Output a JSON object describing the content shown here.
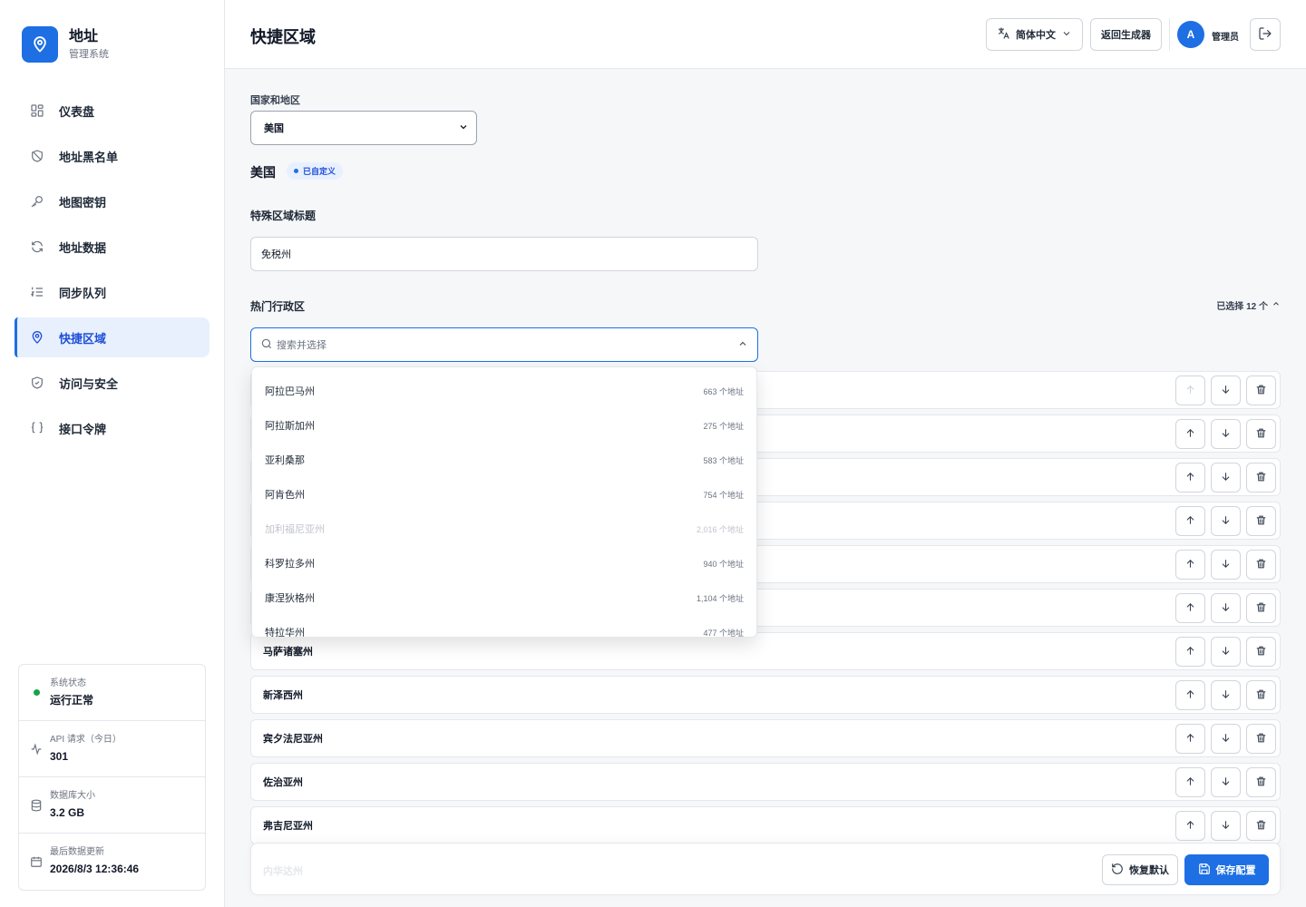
{
  "brand": {
    "title": "地址",
    "subtitle": "管理系统"
  },
  "nav": [
    {
      "label": "仪表盘",
      "icon": "dashboard-icon"
    },
    {
      "label": "地址黑名单",
      "icon": "shield-slash-icon"
    },
    {
      "label": "地图密钥",
      "icon": "key-icon"
    },
    {
      "label": "地址数据",
      "icon": "refresh-icon"
    },
    {
      "label": "同步队列",
      "icon": "list-ordered-icon"
    },
    {
      "label": "快捷区域",
      "icon": "map-pin-icon",
      "active": true
    },
    {
      "label": "访问与安全",
      "icon": "shield-check-icon"
    },
    {
      "label": "接口令牌",
      "icon": "braces-icon"
    }
  ],
  "status": {
    "system_label": "系统状态",
    "system_value": "运行正常",
    "api_label": "API 请求（今日）",
    "api_value": "301",
    "db_label": "数据库大小",
    "db_value": "3.2 GB",
    "update_label": "最后数据更新",
    "update_value": "2026/8/3 12:36:46"
  },
  "header": {
    "title": "快捷区域",
    "language": "简体中文",
    "back_label": "返回生成器",
    "avatar_initial": "A",
    "user_name": "管理员"
  },
  "form": {
    "country_label": "国家和地区",
    "country_value": "美国",
    "country_heading": "美国",
    "custom_badge": "已自定义",
    "special_title_label": "特殊区域标题",
    "special_title_value": "免税州",
    "popular_label": "热门行政区",
    "selected_count": "已选择 12 个",
    "search_placeholder": "搜索并选择"
  },
  "dropdown": [
    {
      "name": "阿拉巴马州",
      "count": "663 个地址",
      "disabled": false
    },
    {
      "name": "阿拉斯加州",
      "count": "275 个地址",
      "disabled": false
    },
    {
      "name": "亚利桑那",
      "count": "583 个地址",
      "disabled": false
    },
    {
      "name": "阿肯色州",
      "count": "754 个地址",
      "disabled": false
    },
    {
      "name": "加利福尼亚州",
      "count": "2,016 个地址",
      "disabled": true
    },
    {
      "name": "科罗拉多州",
      "count": "940 个地址",
      "disabled": false
    },
    {
      "name": "康涅狄格州",
      "count": "1,104 个地址",
      "disabled": false
    },
    {
      "name": "特拉华州",
      "count": "477 个地址",
      "disabled": false
    }
  ],
  "rows": [
    {
      "name": ""
    },
    {
      "name": ""
    },
    {
      "name": ""
    },
    {
      "name": ""
    },
    {
      "name": ""
    },
    {
      "name": ""
    },
    {
      "name": "马萨诸塞州"
    },
    {
      "name": "新泽西州"
    },
    {
      "name": "宾夕法尼亚州"
    },
    {
      "name": "佐治亚州"
    },
    {
      "name": "弗吉尼亚州"
    }
  ],
  "footer": {
    "ghost_row": "内华达州",
    "restore_label": "恢复默认",
    "save_label": "保存配置"
  },
  "colors": {
    "accent": "#1d6fe3",
    "active_bg": "#e8f0fe",
    "status_ok": "#16a34a"
  }
}
